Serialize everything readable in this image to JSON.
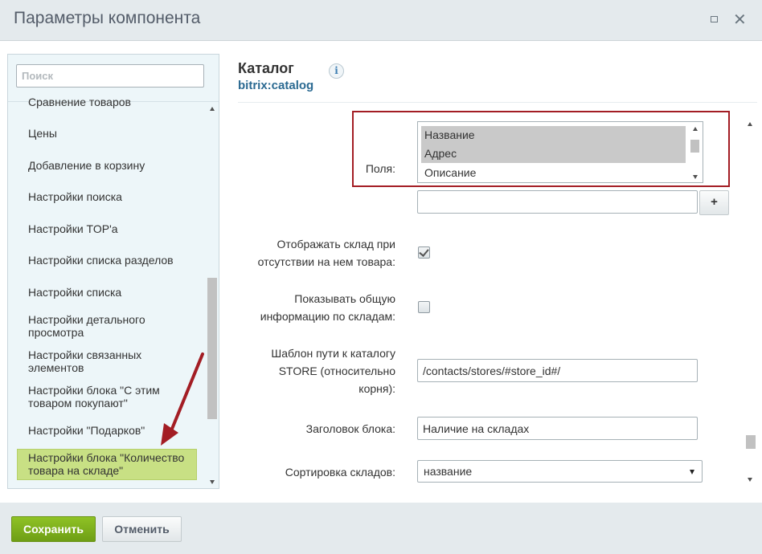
{
  "window": {
    "title": "Параметры компонента"
  },
  "sidebar": {
    "search_placeholder": "Поиск",
    "items": [
      "Сравнение товаров",
      "Цены",
      "Добавление в корзину",
      "Настройки поиска",
      "Настройки TOP'а",
      "Настройки списка разделов",
      "Настройки списка",
      "Настройки детального просмотра",
      "Настройки связанных элементов",
      "Настройки блока \"С этим товаром покупают\"",
      "Настройки \"Подарков\"",
      "Настройки блока \"Количество товара на складе\""
    ],
    "active_item_index": 11
  },
  "component": {
    "title": "Каталог",
    "code": "bitrix:catalog",
    "info_icon": "info-icon"
  },
  "form": {
    "fields": {
      "label": "Поля:",
      "options": [
        {
          "text": "Название",
          "selected": true
        },
        {
          "text": "Адрес",
          "selected": true
        },
        {
          "text": "Описание",
          "selected": false
        }
      ],
      "new_field_value": "",
      "add_label": "+"
    },
    "show_store_missing": {
      "label_line1": "Отображать склад при",
      "label_line2": "отсутствии на нем товара:",
      "checked": true
    },
    "show_general_info": {
      "label_line1": "Показывать общую",
      "label_line2": "информацию по складам:",
      "checked": false
    },
    "store_path": {
      "label_line1": "Шаблон пути к каталогу",
      "label_line2": "STORE (относительно",
      "label_line3": "корня):",
      "value": "/contacts/stores/#store_id#/"
    },
    "block_title": {
      "label": "Заголовок блока:",
      "value": "Наличие на складах"
    },
    "store_sort": {
      "label": "Сортировка складов:",
      "value": "название"
    }
  },
  "footer": {
    "save_label": "Сохранить",
    "cancel_label": "Отменить"
  },
  "colors": {
    "save_green": "#7cb01b",
    "highlight_red": "#a31d24",
    "active_item": "#c8e084",
    "link_blue": "#2b6a92"
  }
}
